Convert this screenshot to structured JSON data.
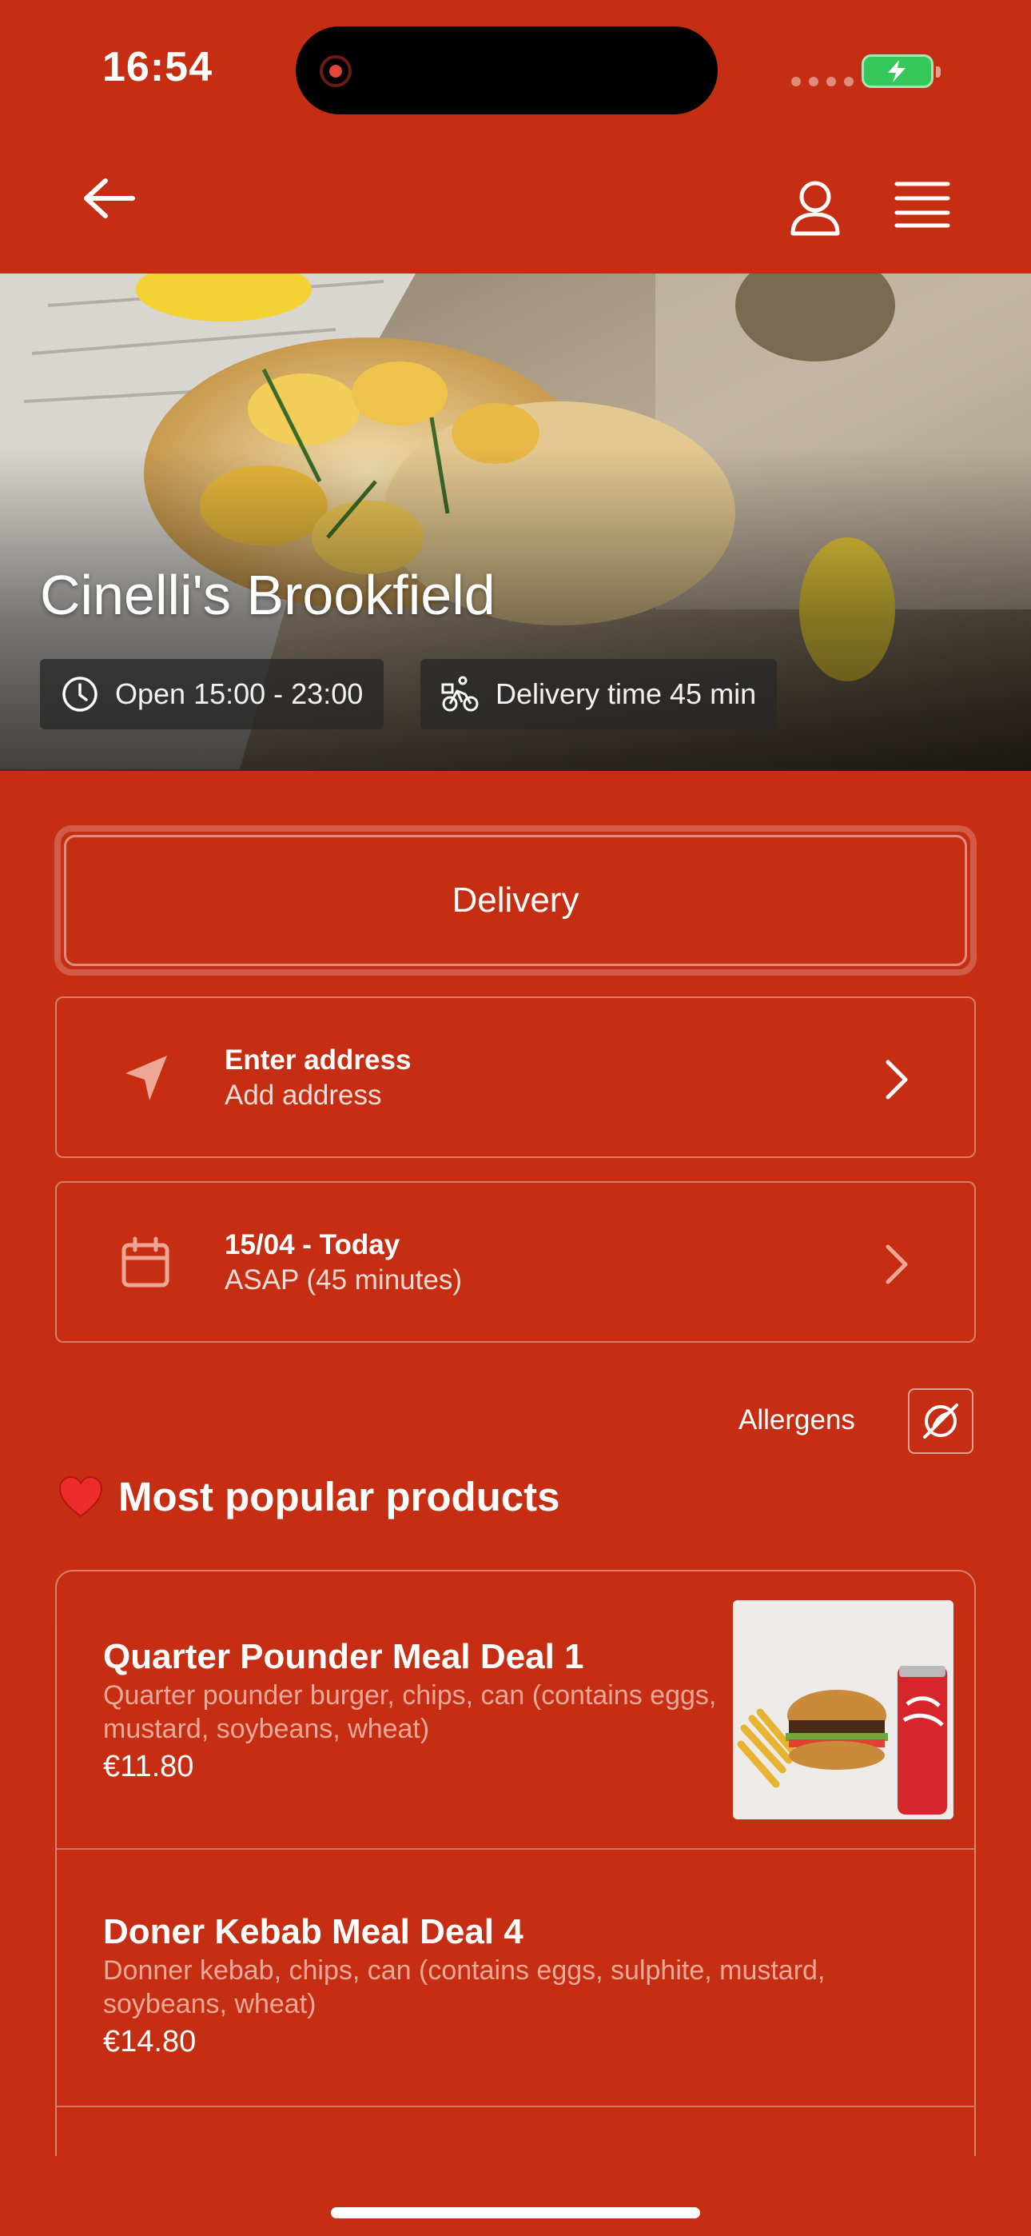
{
  "status_bar": {
    "time": "16:54"
  },
  "nav": {
    "back_icon": "arrow-left-icon",
    "profile_icon": "user-icon",
    "menu_icon": "hamburger-menu-icon"
  },
  "hero": {
    "restaurant_name": "Cinelli's Brookfield",
    "hours": "Open 15:00 - 23:00",
    "delivery_time": "Delivery time 45 min"
  },
  "order": {
    "mode_label": "Delivery",
    "address": {
      "title": "Enter address",
      "subtitle": "Add address",
      "icon": "location-arrow-icon"
    },
    "time": {
      "title": "15/04 - Today",
      "subtitle": "ASAP (45 minutes)",
      "icon": "calendar-icon"
    }
  },
  "allergens": {
    "label": "Allergens",
    "icon": "no-allergens-icon"
  },
  "section": {
    "title": "Most popular products",
    "icon": "heart-icon"
  },
  "products": [
    {
      "name": "Quarter Pounder Meal Deal 1",
      "description": "Quarter pounder burger, chips, can (contains eggs, mustard, soybeans, wheat)",
      "price": "€11.80"
    },
    {
      "name": "Doner Kebab Meal Deal 4",
      "description": "Donner kebab, chips, can (contains eggs, sulphite, mustard, soybeans, wheat)",
      "price": "€14.80"
    }
  ],
  "colors": {
    "background": "#C52E12",
    "text": "#FFFFFF",
    "muted_text": "#EDA898"
  }
}
